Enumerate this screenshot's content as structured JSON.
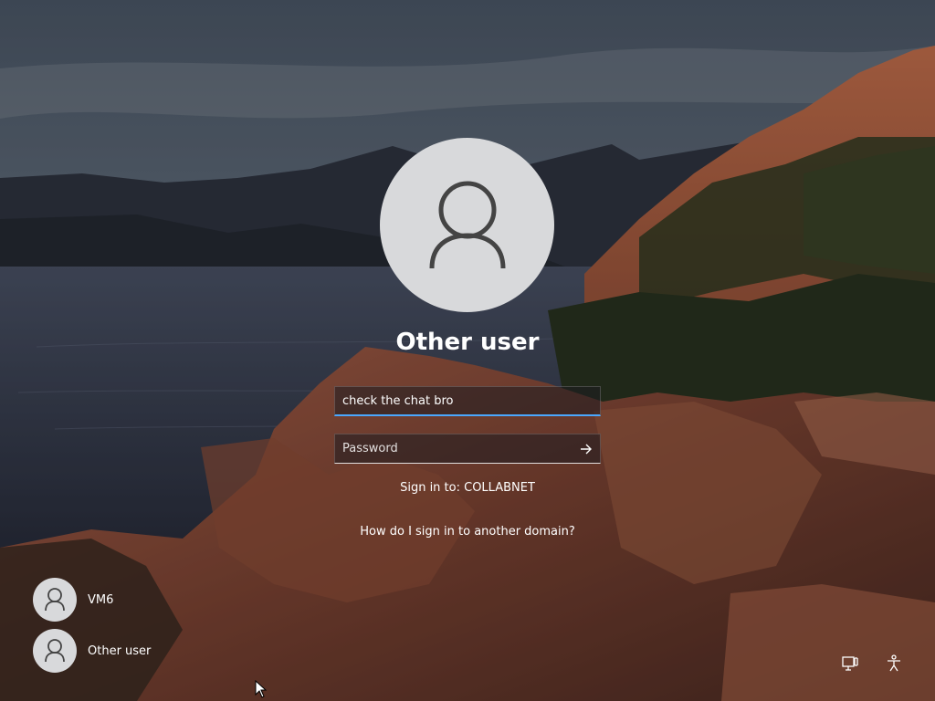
{
  "login": {
    "user_name": "Other user",
    "username_value": "check the chat bro",
    "password_placeholder": "Password",
    "sign_in_to": "Sign in to: COLLABNET",
    "domain_help": "How do I sign in to another domain?"
  },
  "user_list": [
    {
      "label": "VM6"
    },
    {
      "label": "Other user"
    }
  ],
  "icons": {
    "submit": "arrow-right-icon",
    "network": "network-icon",
    "accessibility": "accessibility-icon"
  },
  "colors": {
    "focus_accent": "#4aa8ff",
    "avatar_bg": "#d8d9db",
    "avatar_glyph": "#444444"
  }
}
